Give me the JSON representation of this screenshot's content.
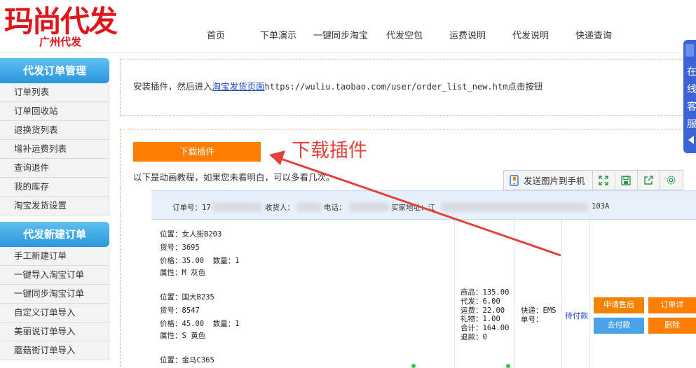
{
  "logo": {
    "main": "玛尚代发",
    "sub": "广州代发"
  },
  "nav": [
    "首页",
    "下单演示",
    "一键同步淘宝",
    "代发空包",
    "运费说明",
    "代发说明",
    "快递查询"
  ],
  "sidebar": {
    "sections": [
      {
        "title": "代发订单管理",
        "items": [
          "订单列表",
          "订单回收站",
          "退换货列表",
          "增补运费列表",
          "查询退件",
          "我的库存",
          "淘宝发货设置"
        ]
      },
      {
        "title": "代发新建订单",
        "items": [
          "手工新建订单",
          "一键导入淘宝订单",
          "一键同步淘宝订单",
          "自定义订单导入",
          "美丽说订单导入",
          "蘑菇街订单导入"
        ]
      }
    ]
  },
  "install": {
    "prefix": "安装插件，然后进入",
    "link": "淘宝发货页面",
    "url": "https://wuliu.taobao.com/user/order_list_new.htm",
    "suffix": "点击按钮"
  },
  "download_button": "下载插件",
  "tutorial_text": "以下是动画教程，如果您未看明白，可以多看几次。",
  "annotation": "下载插件",
  "toolbar": {
    "send_label": "发送图片到手机",
    "icons": [
      "phone-send-icon",
      "expand-icon",
      "save-icon",
      "share-icon",
      "settings-icon"
    ]
  },
  "order": {
    "header": {
      "order_no": "订单号：17",
      "receiver": "收货人：",
      "phone": "电话：",
      "address": "买家地址：江",
      "address_tail": "103A"
    },
    "items": [
      {
        "location": "位置：女人街B203",
        "sku": "货号：3695",
        "price": "价格：35.00",
        "qty": "数量：1",
        "attr": "属性：M 灰色"
      },
      {
        "location": "位置：国大B235",
        "sku": "货号：8547",
        "price": "价格：45.00",
        "qty": "数量：1",
        "attr": "属性：S 黄色"
      },
      {
        "location": "位置：金马C365"
      }
    ],
    "totals": [
      "商品：135.00",
      "代发：6.00",
      "运费：22.00",
      "礼物：1.00",
      "合计：164.00",
      "退款：0"
    ],
    "express": "快递：EMS",
    "waybill": "单号：",
    "status": "待付款",
    "actions": {
      "after_sale": "申请售后",
      "order_detail": "订单详",
      "pay": "去付款",
      "delete": "删除"
    }
  },
  "service": {
    "text": [
      "在",
      "线",
      "客",
      "服"
    ]
  },
  "colors": {
    "brand_red": "#e0141b",
    "accent_orange": "#ff7d00",
    "sidebar_blue": "#2a96dc",
    "service_blue": "#3b63d6",
    "link_blue": "#1a4cc7",
    "annotation_red": "#e5403b"
  }
}
